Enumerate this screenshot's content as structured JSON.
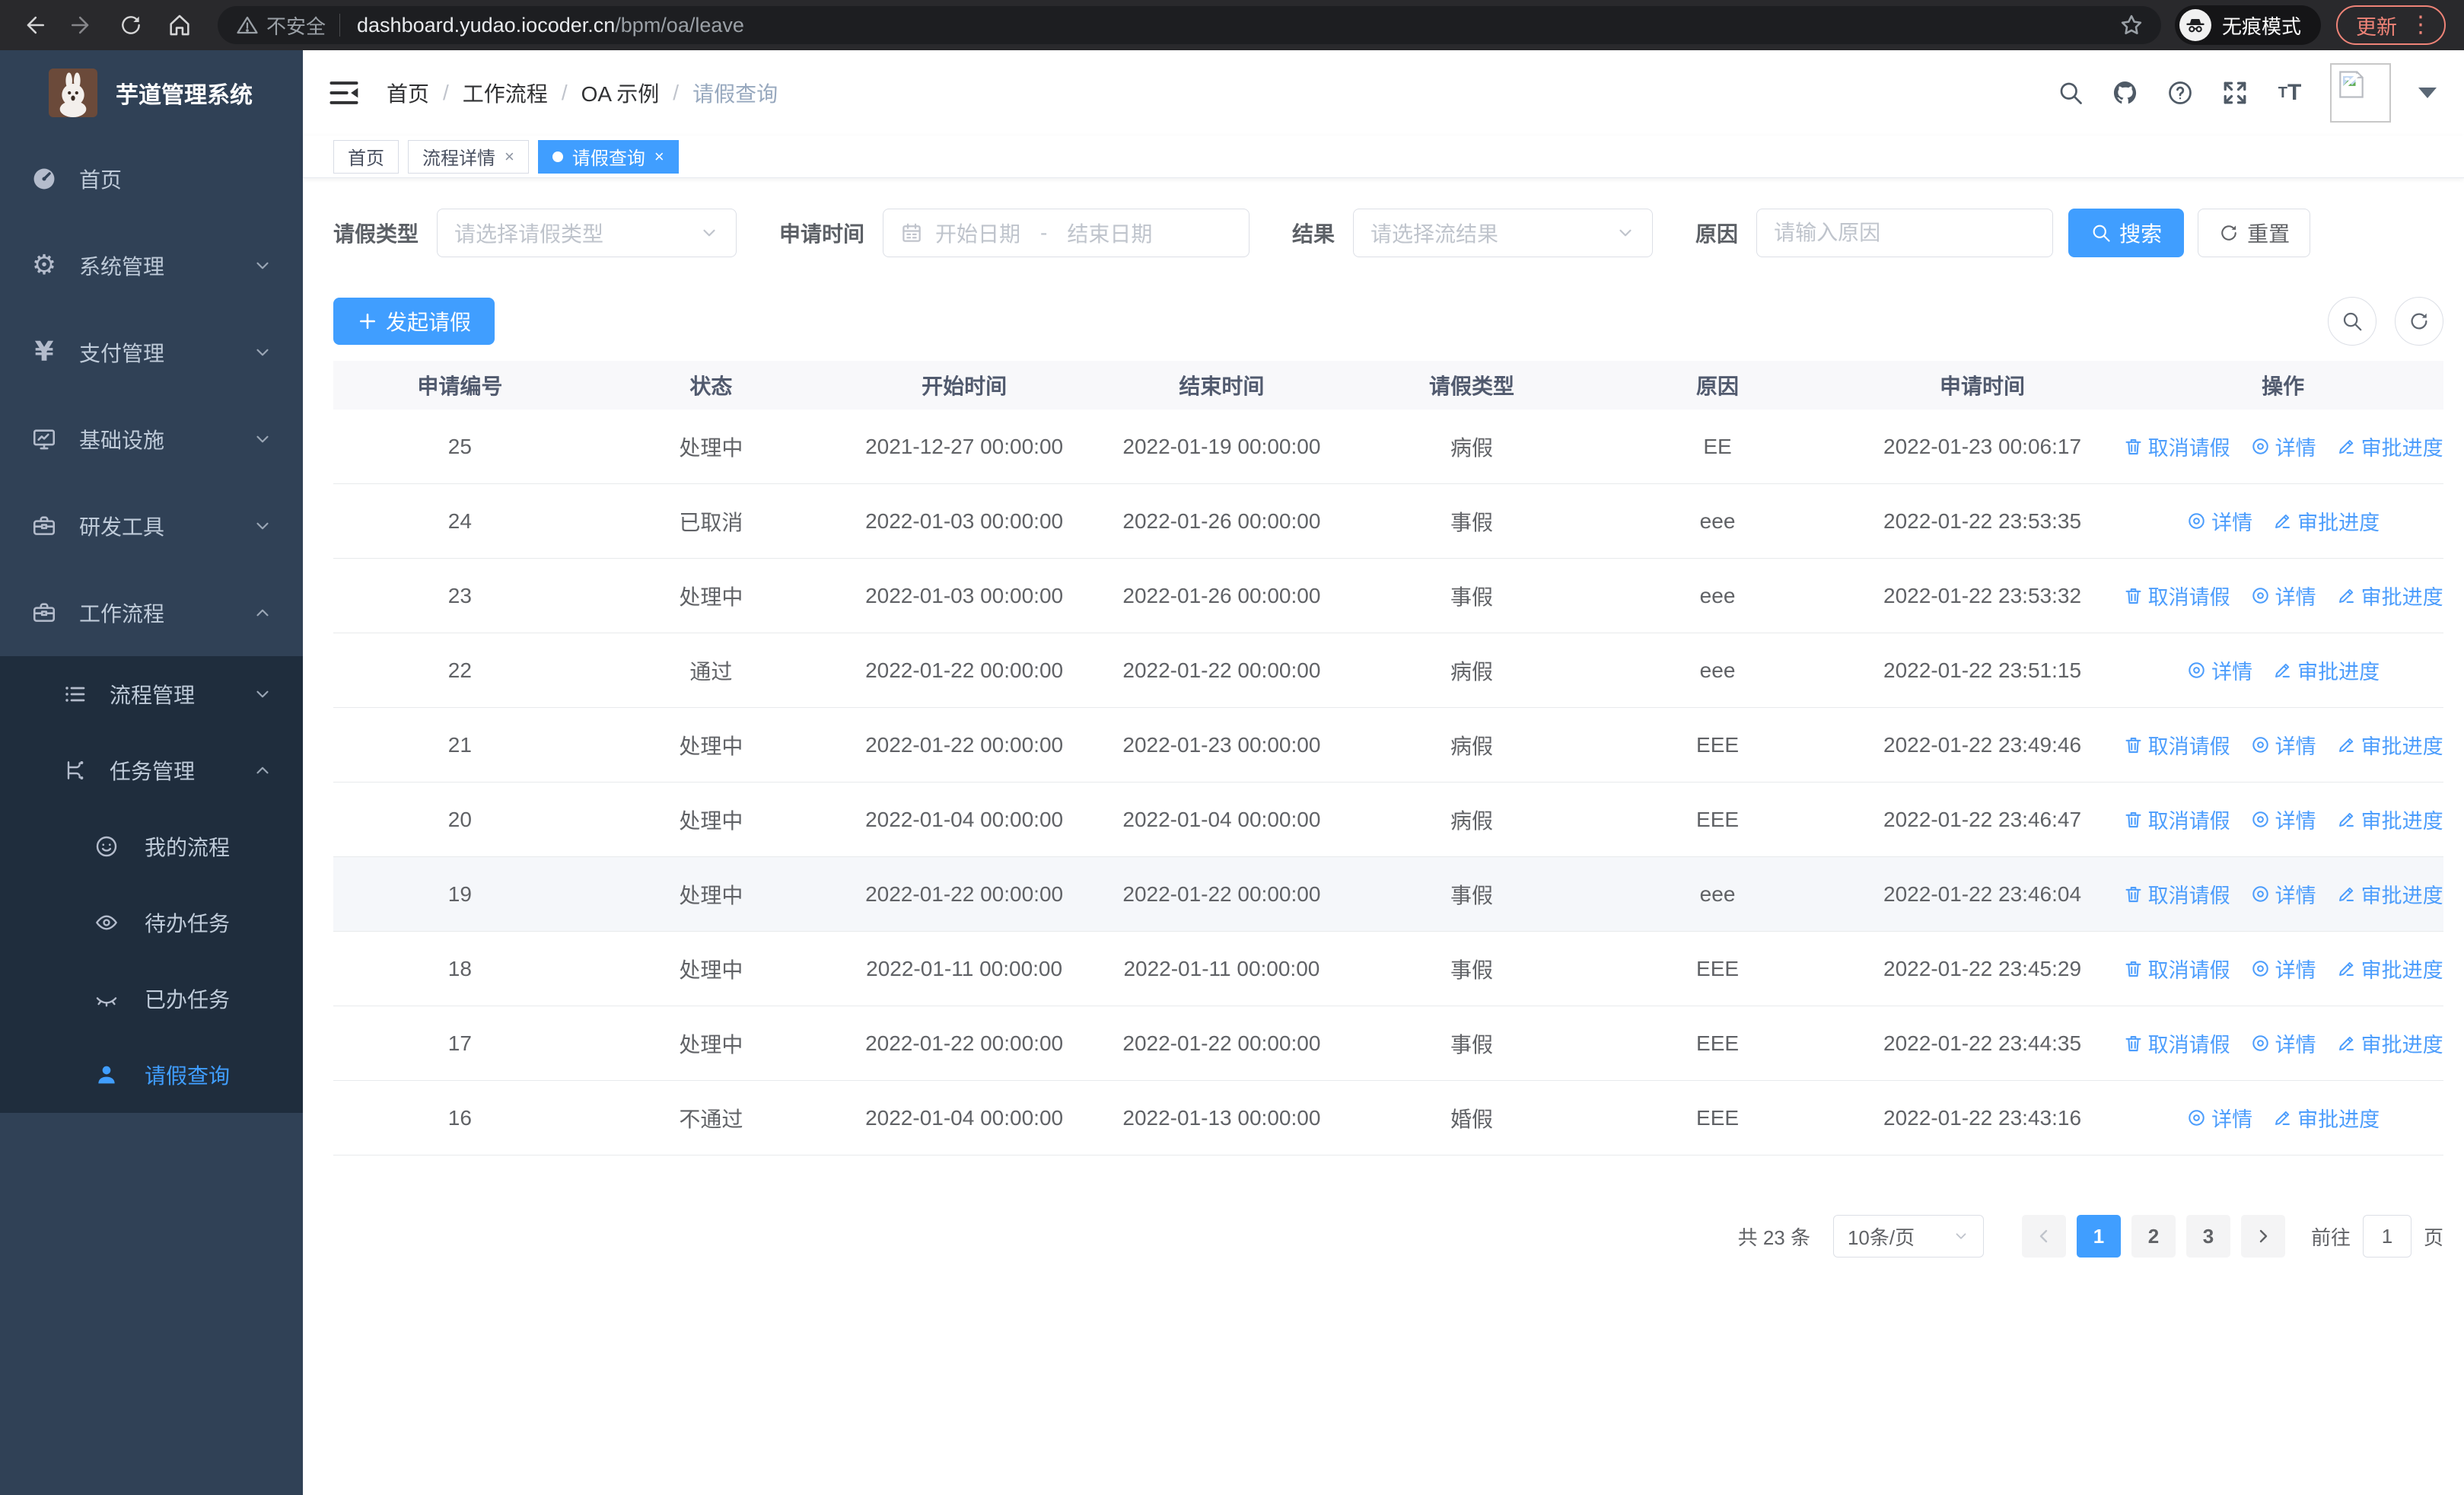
{
  "browser": {
    "security_warning": "不安全",
    "url_host": "dashboard.yudao.iocoder.cn",
    "url_path": "/bpm/oa/leave",
    "incognito_label": "无痕模式",
    "update_label": "更新"
  },
  "colors": {
    "primary": "#409eff",
    "sidebar_bg": "#304156",
    "submenu_bg": "#1f2d3d",
    "update_accent": "#ee8377"
  },
  "sidebar": {
    "app_title": "芋道管理系统",
    "items": [
      {
        "label": "首页",
        "expandable": false
      },
      {
        "label": "系统管理",
        "expandable": true
      },
      {
        "label": "支付管理",
        "expandable": true
      },
      {
        "label": "基础设施",
        "expandable": true
      },
      {
        "label": "研发工具",
        "expandable": true
      },
      {
        "label": "工作流程",
        "expandable": true,
        "expanded": true
      }
    ],
    "submenu": [
      {
        "label": "流程管理",
        "expanded": false
      },
      {
        "label": "任务管理",
        "expanded": true
      }
    ],
    "task_items": [
      {
        "label": "我的流程"
      },
      {
        "label": "待办任务"
      },
      {
        "label": "已办任务"
      },
      {
        "label": "请假查询",
        "active": true
      }
    ]
  },
  "header": {
    "breadcrumb": [
      "首页",
      "工作流程",
      "OA 示例",
      "请假查询"
    ],
    "separator": "/"
  },
  "tabs": [
    {
      "label": "首页"
    },
    {
      "label": "流程详情",
      "close": "×"
    },
    {
      "label": "请假查询",
      "close": "×",
      "active": true
    }
  ],
  "filters": {
    "leave_type_label": "请假类型",
    "leave_type_placeholder": "请选择请假类型",
    "apply_time_label": "申请时间",
    "start_date_placeholder": "开始日期",
    "date_separator": "-",
    "end_date_placeholder": "结束日期",
    "result_label": "结果",
    "result_placeholder": "请选择流结果",
    "reason_label": "原因",
    "reason_placeholder": "请输入原因",
    "search_label": "搜索",
    "reset_label": "重置"
  },
  "toolbar": {
    "create_label": "发起请假"
  },
  "table": {
    "headers": [
      "申请编号",
      "状态",
      "开始时间",
      "结束时间",
      "请假类型",
      "原因",
      "申请时间",
      "操作"
    ],
    "action_labels": {
      "cancel": "取消请假",
      "detail": "详情",
      "progress": "审批进度"
    },
    "rows": [
      {
        "id": "25",
        "status": "处理中",
        "start": "2021-12-27 00:00:00",
        "end": "2022-01-19 00:00:00",
        "type": "病假",
        "reason": "EE",
        "applied": "2022-01-23 00:06:17",
        "can_cancel": true
      },
      {
        "id": "24",
        "status": "已取消",
        "start": "2022-01-03 00:00:00",
        "end": "2022-01-26 00:00:00",
        "type": "事假",
        "reason": "eee",
        "applied": "2022-01-22 23:53:35",
        "can_cancel": false
      },
      {
        "id": "23",
        "status": "处理中",
        "start": "2022-01-03 00:00:00",
        "end": "2022-01-26 00:00:00",
        "type": "事假",
        "reason": "eee",
        "applied": "2022-01-22 23:53:32",
        "can_cancel": true
      },
      {
        "id": "22",
        "status": "通过",
        "start": "2022-01-22 00:00:00",
        "end": "2022-01-22 00:00:00",
        "type": "病假",
        "reason": "eee",
        "applied": "2022-01-22 23:51:15",
        "can_cancel": false
      },
      {
        "id": "21",
        "status": "处理中",
        "start": "2022-01-22 00:00:00",
        "end": "2022-01-23 00:00:00",
        "type": "病假",
        "reason": "EEE",
        "applied": "2022-01-22 23:49:46",
        "can_cancel": true
      },
      {
        "id": "20",
        "status": "处理中",
        "start": "2022-01-04 00:00:00",
        "end": "2022-01-04 00:00:00",
        "type": "病假",
        "reason": "EEE",
        "applied": "2022-01-22 23:46:47",
        "can_cancel": true
      },
      {
        "id": "19",
        "status": "处理中",
        "start": "2022-01-22 00:00:00",
        "end": "2022-01-22 00:00:00",
        "type": "事假",
        "reason": "eee",
        "applied": "2022-01-22 23:46:04",
        "can_cancel": true,
        "highlight": true
      },
      {
        "id": "18",
        "status": "处理中",
        "start": "2022-01-11 00:00:00",
        "end": "2022-01-11 00:00:00",
        "type": "事假",
        "reason": "EEE",
        "applied": "2022-01-22 23:45:29",
        "can_cancel": true
      },
      {
        "id": "17",
        "status": "处理中",
        "start": "2022-01-22 00:00:00",
        "end": "2022-01-22 00:00:00",
        "type": "事假",
        "reason": "EEE",
        "applied": "2022-01-22 23:44:35",
        "can_cancel": true
      },
      {
        "id": "16",
        "status": "不通过",
        "start": "2022-01-04 00:00:00",
        "end": "2022-01-13 00:00:00",
        "type": "婚假",
        "reason": "EEE",
        "applied": "2022-01-22 23:43:16",
        "can_cancel": false
      }
    ]
  },
  "pagination": {
    "total_text": "共 23 条",
    "page_size": "10条/页",
    "pages": [
      "1",
      "2",
      "3"
    ],
    "goto_label": "前往",
    "goto_value": "1",
    "page_suffix": "页"
  }
}
